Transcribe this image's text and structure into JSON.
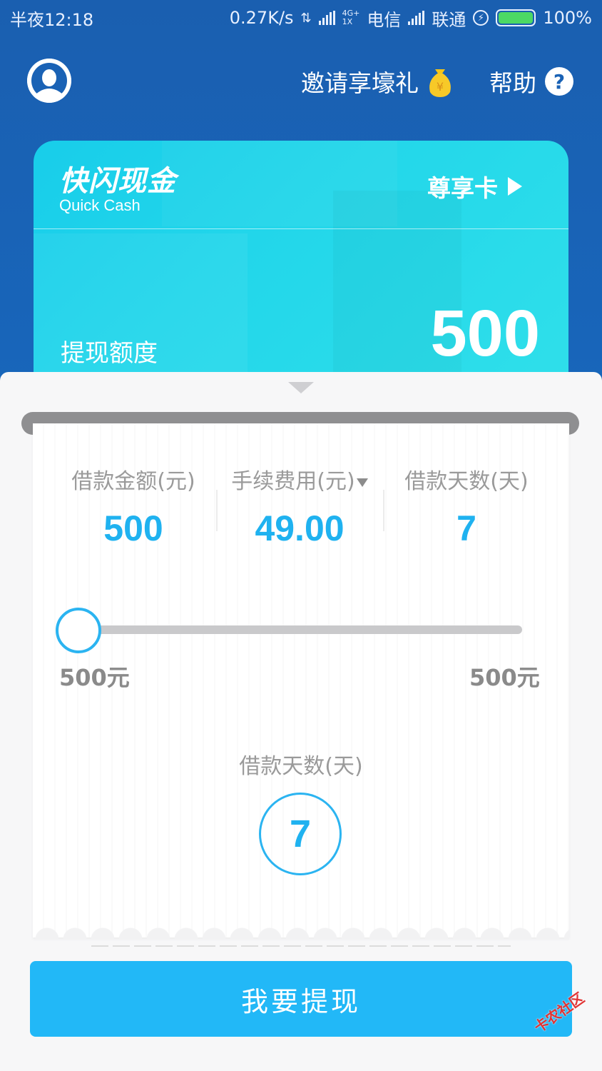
{
  "status_bar": {
    "time": "半夜12:18",
    "speed": "0.27K/s",
    "network_tag_top": "4G+",
    "network_tag_bottom": "1X",
    "carrier1": "电信",
    "carrier2": "联通",
    "battery": "100%"
  },
  "header": {
    "invite_label": "邀请享壕礼",
    "help_label": "帮助",
    "help_icon_glyph": "?",
    "money_symbol": "¥"
  },
  "card": {
    "brand_cn": "快闪现金",
    "brand_en": "Quick Cash",
    "vip_label": "尊享卡",
    "limit_label": "提现额度",
    "limit_value": "500"
  },
  "loan": {
    "amount_label": "借款金额(元)",
    "amount_value": "500",
    "fee_label": "手续费用(元)",
    "fee_value": "49.00",
    "days_label": "借款天数(天)",
    "days_value": "7"
  },
  "slider": {
    "min_label": "500元",
    "max_label": "500元",
    "fraction": 0.0
  },
  "days_picker": {
    "label": "借款天数(天)",
    "value": "7"
  },
  "action": {
    "withdraw_label": "我要提现"
  },
  "watermark": "卡农社区",
  "colors": {
    "header_blue": "#1a62b5",
    "card_cyan": "#1fd3ea",
    "accent_blue": "#1fb2f0",
    "button_blue": "#22b8f7"
  }
}
